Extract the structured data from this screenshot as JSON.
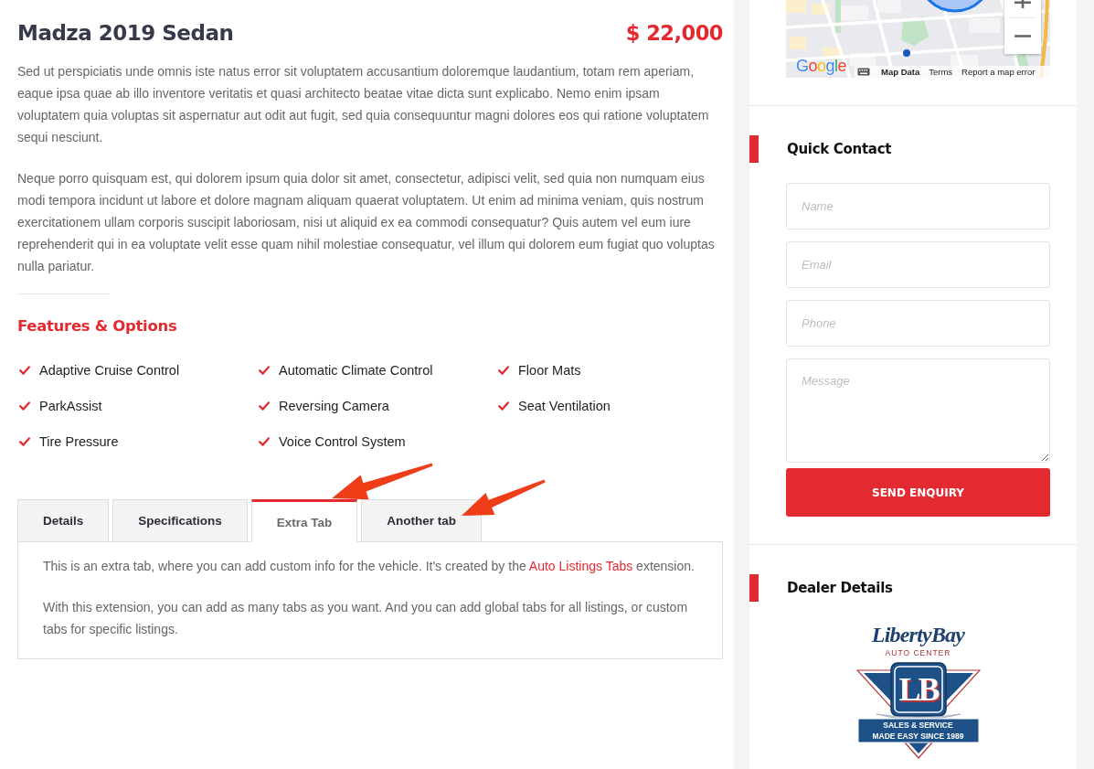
{
  "listing": {
    "title": "Madza 2019 Sedan",
    "price": "$ 22,000",
    "description": [
      "Sed ut perspiciatis unde omnis iste natus error sit voluptatem accusantium doloremque laudantium, totam rem aperiam, eaque ipsa quae ab illo inventore veritatis et quasi architecto beatae vitae dicta sunt explicabo. Nemo enim ipsam voluptatem quia voluptas sit aspernatur aut odit aut fugit, sed quia consequuntur magni dolores eos qui ratione voluptatem sequi nesciunt.",
      "Neque porro quisquam est, qui dolorem ipsum quia dolor sit amet, consectetur, adipisci velit, sed quia non numquam eius modi tempora incidunt ut labore et dolore magnam aliquam quaerat voluptatem. Ut enim ad minima veniam, quis nostrum exercitationem ullam corporis suscipit laboriosam, nisi ut aliquid ex ea commodi consequatur? Quis autem vel eum iure reprehenderit qui in ea voluptate velit esse quam nihil molestiae consequatur, vel illum qui dolorem eum fugiat quo voluptas nulla pariatur."
    ]
  },
  "features": {
    "heading": "Features & Options",
    "items": [
      "Adaptive Cruise Control",
      "Automatic Climate Control",
      "Floor Mats",
      "ParkAssist",
      "Reversing Camera",
      "Seat Ventilation",
      "Tire Pressure",
      "Voice Control System"
    ]
  },
  "tabs": [
    {
      "label": "Details",
      "selected": false
    },
    {
      "label": "Specifications",
      "selected": false
    },
    {
      "label": "Extra Tab",
      "selected": true
    },
    {
      "label": "Another tab",
      "selected": false
    }
  ],
  "tab_panel": {
    "paragraphs": [
      {
        "text": "This is an extra tab, where you can add custom info for the vehicle. It's created by the ",
        "link": "Auto Listings Tabs",
        "text_after": " extension."
      },
      {
        "text": "With this extension, you can add as many tabs as you want. And you can add global tabs for all listings, or custom tabs for specific listings."
      }
    ]
  },
  "sidebar": {
    "map": {
      "logo": "Google",
      "map_data_link": "Map Data",
      "terms_link": "Terms",
      "report_link": "Report a map error"
    },
    "quick_contact": {
      "heading": "Quick Contact",
      "fields": [
        {
          "kind": "input",
          "placeholder": "Name"
        },
        {
          "kind": "input",
          "placeholder": "Email"
        },
        {
          "kind": "input",
          "placeholder": "Phone"
        },
        {
          "kind": "textarea",
          "placeholder": "Message"
        }
      ],
      "button": "SEND ENQUIRY"
    },
    "dealer_details": {
      "heading": "Dealer Details",
      "logo": {
        "wordmark": "LibertyBay",
        "subtitle": "AUTO CENTER",
        "monogram": "LB",
        "slogan": [
          "SALES & SERVICE",
          "MADE EASY SINCE 1989"
        ]
      }
    }
  }
}
